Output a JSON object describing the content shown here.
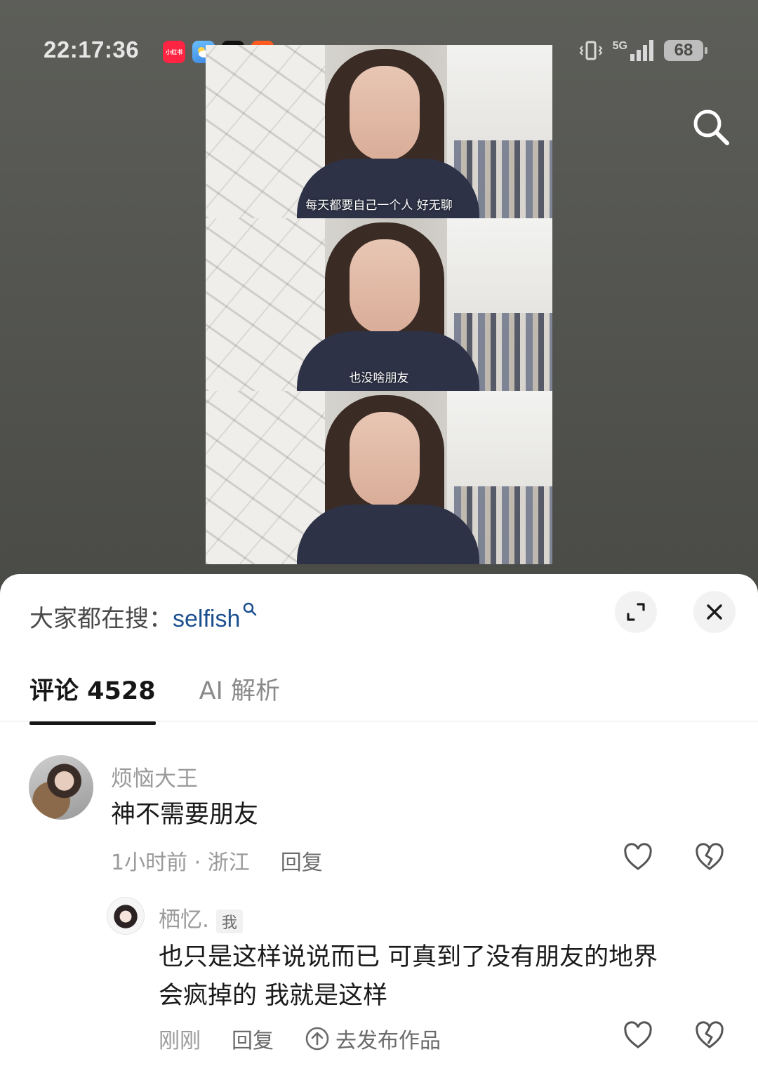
{
  "status_bar": {
    "time": "22:17:36",
    "network": "5G",
    "battery": "68",
    "apps": [
      {
        "name": "xiaohongshu-app-icon",
        "label": "小红书",
        "color": "#ff2442"
      },
      {
        "name": "weather-app-icon",
        "label": "",
        "color": "#4aa3f0"
      },
      {
        "name": "tiktok-app-icon",
        "label": "",
        "color": "#111111"
      },
      {
        "name": "kuaishou-app-icon",
        "label": "",
        "color": "#ff5a1f"
      }
    ]
  },
  "video": {
    "captions": [
      "每天都要自己一个人 好无聊",
      "也没啥朋友",
      ""
    ]
  },
  "comment_sheet": {
    "hot_search_prefix": "大家都在搜：",
    "hot_search_term": "selfish",
    "tabs": [
      {
        "label": "评论 4528",
        "active": true
      },
      {
        "label": "AI 解析",
        "active": false
      }
    ],
    "comments": [
      {
        "username": "烦恼大王",
        "text": "神不需要朋友",
        "time_location": "1小时前 · 浙江",
        "reply_label": "回复",
        "replies": [
          {
            "username": "栖忆.",
            "badge": "我",
            "text_line1": "也只是这样说说而已 可真到了没有朋友的地界",
            "text_line2": "会疯掉的 我就是这样",
            "time": "刚刚",
            "reply_label": "回复",
            "publish_label": "去发布作品"
          }
        ]
      }
    ]
  },
  "colors": {
    "hot_search_term": "#1c4f8f",
    "sheet_bg": "#ffffff",
    "muted_text": "#9a9a9a"
  }
}
